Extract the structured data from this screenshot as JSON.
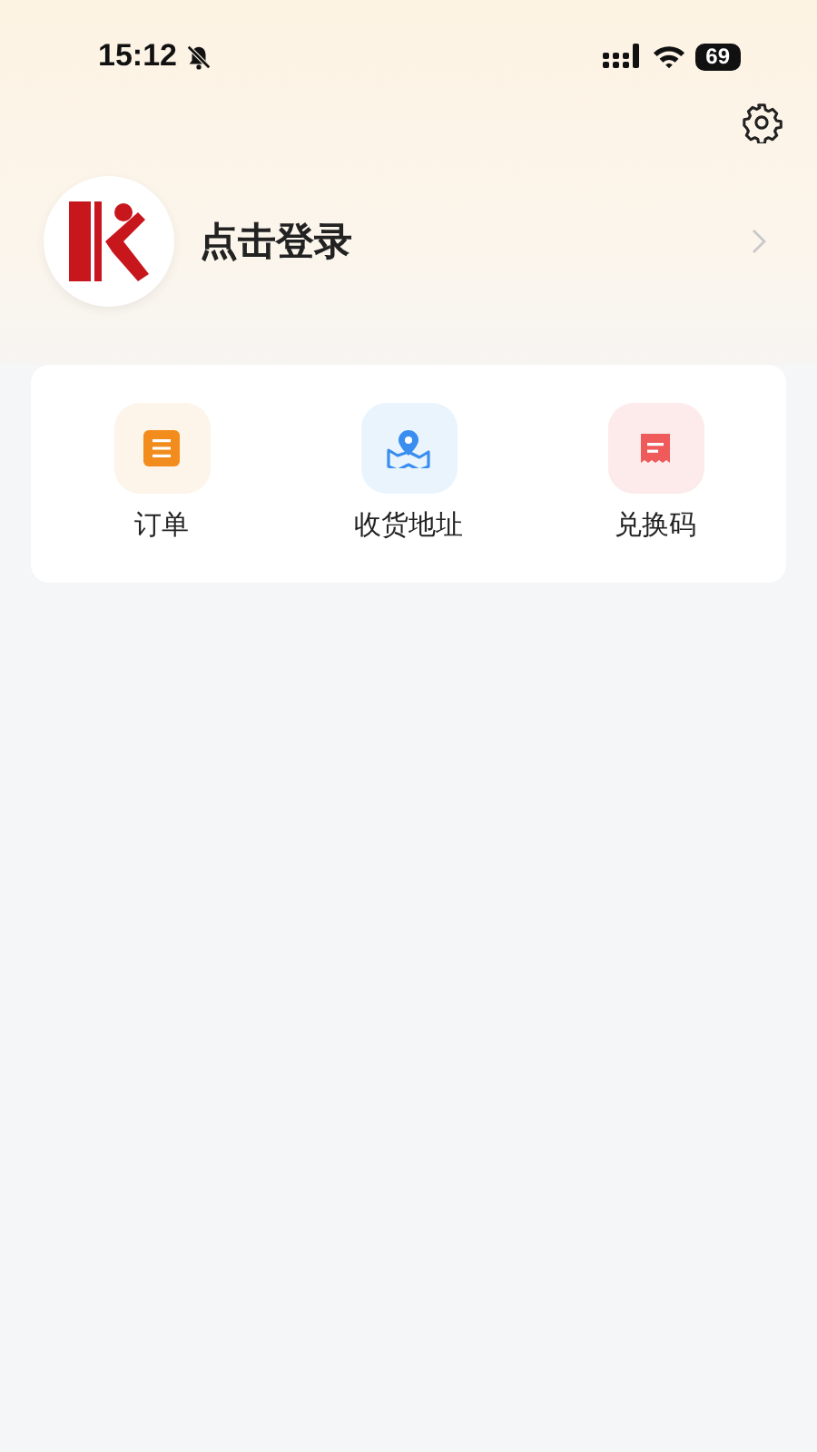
{
  "status_bar": {
    "time": "15:12",
    "battery": "69"
  },
  "profile": {
    "login_text": "点击登录"
  },
  "shortcuts": [
    {
      "kind": "orders",
      "label": "订单"
    },
    {
      "kind": "address",
      "label": "收货地址"
    },
    {
      "kind": "redeem",
      "label": "兑换码"
    }
  ]
}
